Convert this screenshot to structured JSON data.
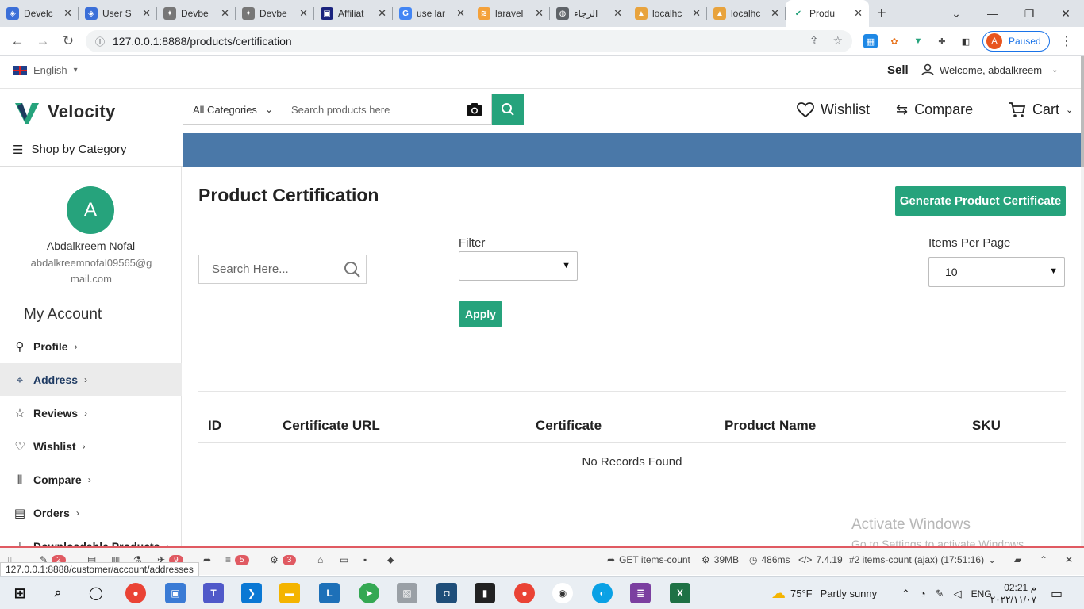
{
  "browser": {
    "tabs": [
      {
        "title": "Develc",
        "color": "#3b6fd8",
        "glyph": "◈"
      },
      {
        "title": "User S",
        "color": "#3b6fd8",
        "glyph": "◈"
      },
      {
        "title": "Devbe",
        "color": "#777777",
        "glyph": "✦"
      },
      {
        "title": "Devbe",
        "color": "#777777",
        "glyph": "✦"
      },
      {
        "title": "Affiliat",
        "color": "#1a237e",
        "glyph": "▣"
      },
      {
        "title": "use lar",
        "color": "#4285f4",
        "glyph": "G"
      },
      {
        "title": "laravel",
        "color": "#f4a13a",
        "glyph": "≋"
      },
      {
        "title": "الرجاء",
        "color": "#5f6368",
        "glyph": "◍"
      },
      {
        "title": "localhc",
        "color": "#e8a33d",
        "glyph": "▲"
      },
      {
        "title": "localhc",
        "color": "#e8a33d",
        "glyph": "▲"
      }
    ],
    "active_tab": {
      "title": "Produ",
      "color": "#26a37c",
      "glyph": "✔"
    },
    "url": "127.0.0.1:8888/products/certification",
    "profile_initial": "A",
    "profile_status": "Paused"
  },
  "site": {
    "language": "English",
    "sell_label": "Sell",
    "welcome": "Welcome, abdalkreem",
    "brand": "Velocity",
    "search": {
      "category": "All Categories",
      "placeholder": "Search products here"
    },
    "nav": {
      "wishlist": "Wishlist",
      "compare": "Compare",
      "cart": "Cart"
    },
    "shop_by_category": "Shop by Category",
    "accent_color": "#26a37c",
    "banner_color": "#4a78a8"
  },
  "sidebar": {
    "avatar_initial": "A",
    "user_name": "Abdalkreem Nofal",
    "user_email": "abdalkreemnofal09565@gmail.com",
    "section_title": "My Account",
    "items": [
      {
        "label": "Profile",
        "icon": "person-icon"
      },
      {
        "label": "Address",
        "icon": "location-pin-icon",
        "active": true
      },
      {
        "label": "Reviews",
        "icon": "star-icon"
      },
      {
        "label": "Wishlist",
        "icon": "heart-icon"
      },
      {
        "label": "Compare",
        "icon": "compare-icon"
      },
      {
        "label": "Orders",
        "icon": "receipt-icon"
      },
      {
        "label": "Downloadable Products",
        "icon": "download-icon"
      }
    ]
  },
  "main": {
    "title": "Product Certification",
    "generate_button": "Generate Product Certificate",
    "search_placeholder": "Search Here...",
    "filter_label": "Filter",
    "filter_value": "",
    "apply_button": "Apply",
    "items_per_page_label": "Items Per Page",
    "items_per_page_value": "10",
    "columns": [
      "ID",
      "Certificate URL",
      "Certificate",
      "Product Name",
      "SKU"
    ],
    "empty_message": "No Records Found",
    "watermark_title": "Activate Windows",
    "watermark_sub": "Go to Settings to activate Windows."
  },
  "debugbar": {
    "badge_1": "2",
    "badge_2": "5",
    "badge_3": "3",
    "badge_4": "9",
    "request": "GET items-count",
    "memory": "39MB",
    "time": "486ms",
    "php_version": "7.4.19",
    "selected_request": "#2 items-count (ajax) (17:51:16)"
  },
  "status_url": "127.0.0.1:8888/customer/account/addresses",
  "taskbar": {
    "weather_temp": "75°F",
    "weather_desc": "Partly sunny",
    "language": "ENG",
    "time": "02:21 م",
    "date": "٢٠٢٢/١١/٠٧"
  }
}
